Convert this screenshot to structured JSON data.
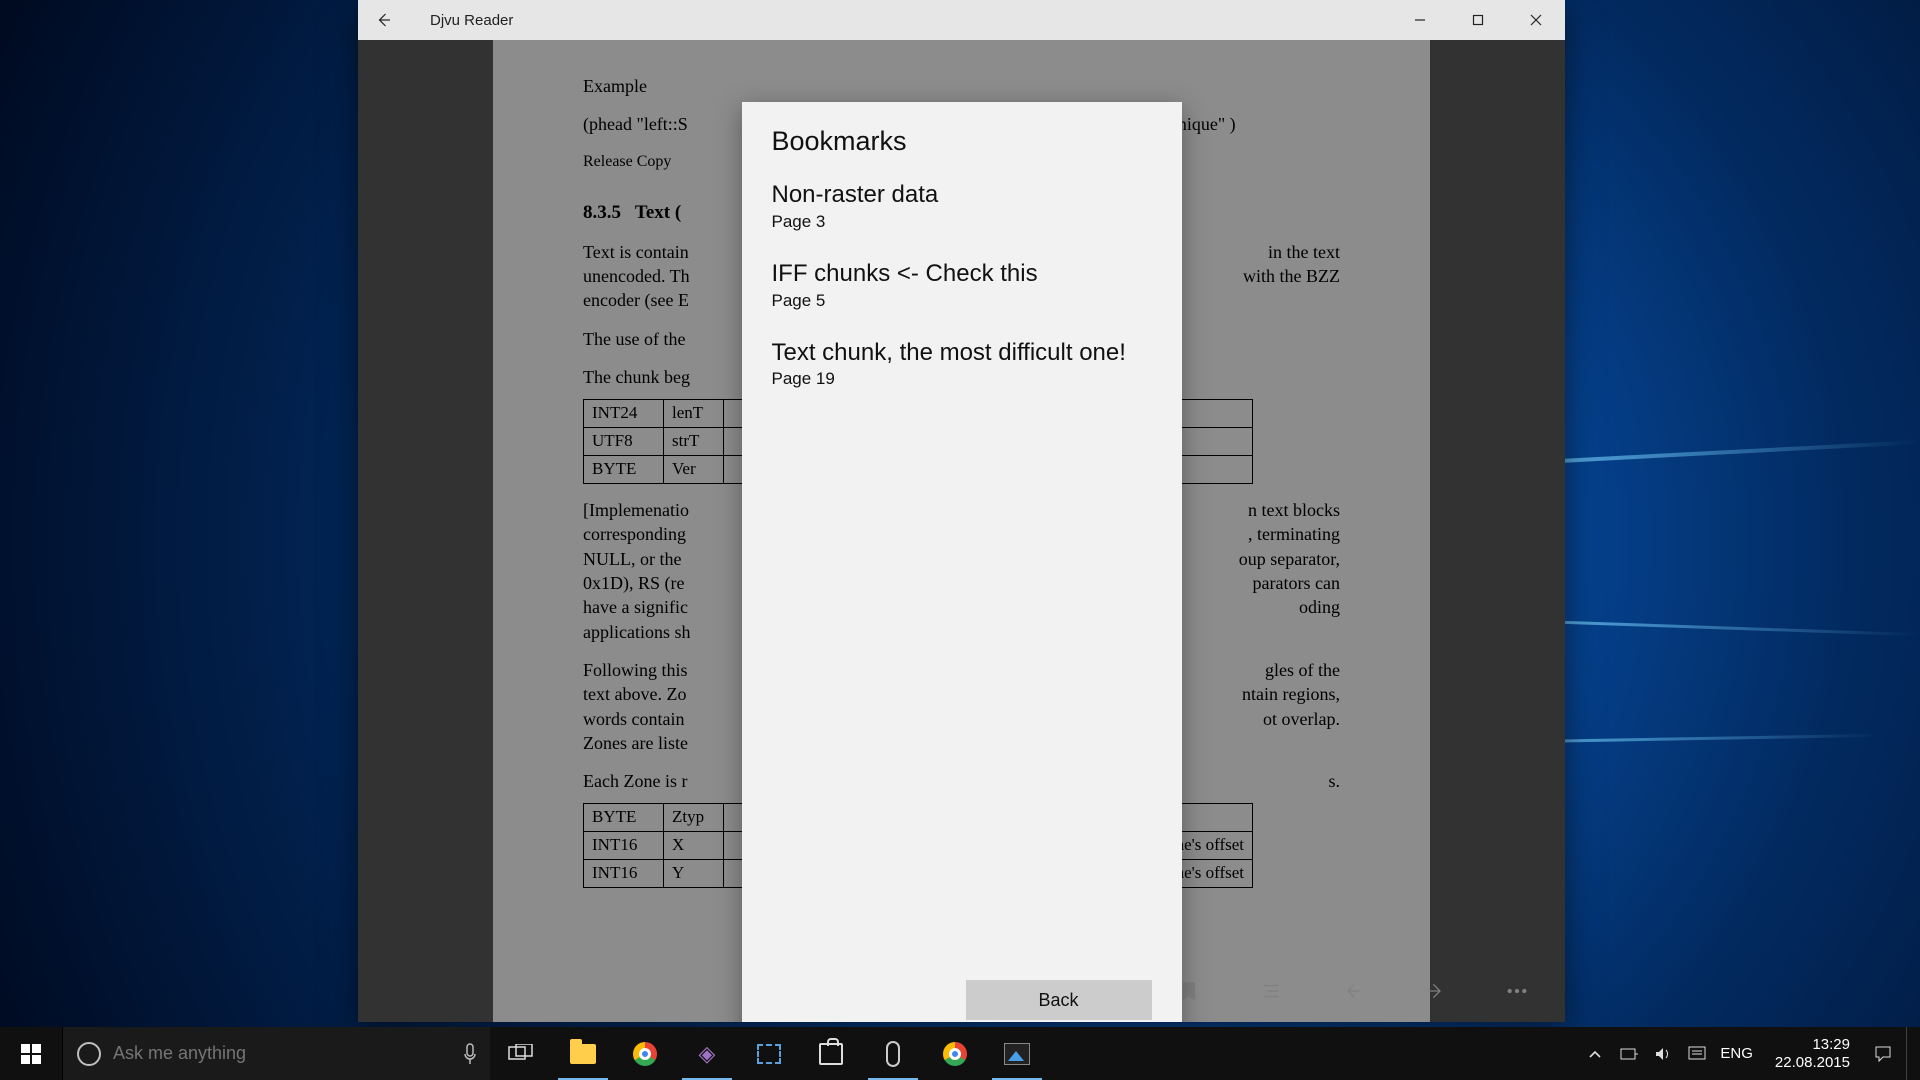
{
  "app": {
    "title": "Djvu Reader"
  },
  "document": {
    "example_label": "Example",
    "phead_left": "(phead \"left::S",
    "phead_right": "Dominique\" )",
    "release": "Release Copy",
    "section_no": "8.3.5",
    "section_title": "Text (",
    "p_text1": "Text is contain",
    "p_text1_r": "in the text",
    "p_text2": "unencoded. Th",
    "p_text2_r": "with the BZZ",
    "p_text3": "encoder (see E",
    "p_use": "The use of the",
    "p_chunk": "The chunk beg",
    "table1": {
      "r1c1": "INT24",
      "r1c2": "lenT",
      "r2c1": "UTF8",
      "r2c2": "strT",
      "r3c1": "BYTE",
      "r3c2": "Ver"
    },
    "impl1": "[Implemenatio",
    "impl1_r": "n text blocks",
    "impl2": "corresponding",
    "impl2_r": ", terminating",
    "impl3": "NULL, or the",
    "impl3_r": "oup separator,",
    "impl4": "0x1D), RS (re",
    "impl4_r": "parators can",
    "impl5": "have a signific",
    "impl5_r": "oding",
    "impl6": "applications sh",
    "foll1": "Following this",
    "foll1_r": "gles of the",
    "foll2": "text above.  Zo",
    "foll2_r": "ntain regions,",
    "foll3": "words contain",
    "foll3_r": "ot overlap.",
    "foll4": "Zones are liste",
    "each": "Each Zone is r",
    "each_r": "s.",
    "table2": {
      "r1c1": "BYTE",
      "r1c2": "Ztyp",
      "r2c1": "INT16",
      "r2c2": "X",
      "r2c3": "one's offset",
      "r3c1": "INT16",
      "r3c2": "Y",
      "r3c3": "one's offset"
    }
  },
  "dialog": {
    "title": "Bookmarks",
    "items": [
      {
        "title": "Non-raster data",
        "page": "Page 3"
      },
      {
        "title": "IFF chunks <- Check this",
        "page": "Page 5"
      },
      {
        "title": "Text chunk, the most difficult one!",
        "page": "Page 19"
      }
    ],
    "back_label": "Back"
  },
  "taskbar": {
    "search_placeholder": "Ask me anything",
    "lang": "ENG",
    "time": "13:29",
    "date": "22.08.2015"
  }
}
